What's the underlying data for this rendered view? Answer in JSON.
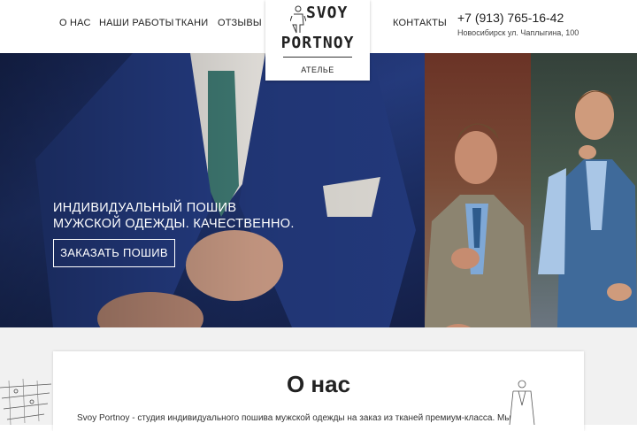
{
  "header": {
    "nav": [
      {
        "label": "О НАС"
      },
      {
        "label": "НАШИ РАБОТЫ"
      },
      {
        "label": "ТКАНИ"
      },
      {
        "label": "ОТЗЫВЫ"
      },
      {
        "label": "КОНТАКТЫ"
      }
    ],
    "phone": "+7 (913) 765-16-42",
    "address": "Новосибирск ул. Чаплыгина, 100"
  },
  "logo": {
    "line1": "SVOY",
    "line2": "PORTNOY",
    "subtitle": "АТЕЛЬЕ",
    "mark_icon": "tailor-figure-icon"
  },
  "hero": {
    "title": "ИНДИВИДУАЛЬНЫЙ ПОШИВ МУЖСКОЙ ОДЕЖДЫ. КАЧЕСТВЕННО.",
    "cta_label": "ЗАКАЗАТЬ ПОШИВ",
    "colors": {
      "suit_blue": "#1f2f6a",
      "brick": "#6a3326",
      "green": "#4a5c4f"
    }
  },
  "about": {
    "title": "О нас",
    "text": "Svoy Portnoy - студия индивидуального пошива мужской одежды на заказ из тканей премиум-класса. Мы"
  }
}
